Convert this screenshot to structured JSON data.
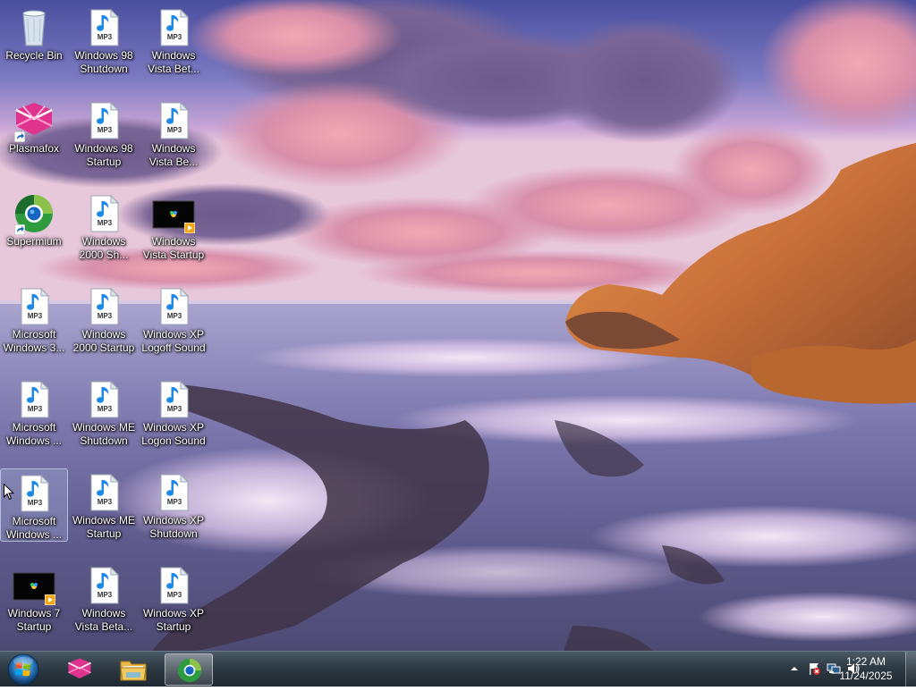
{
  "desktop": {
    "icons": [
      {
        "label": "Recycle Bin",
        "icon": "recycle-bin-icon"
      },
      {
        "label": "Plasmafox",
        "icon": "plasmafox-icon"
      },
      {
        "label": "Supermium",
        "icon": "supermium-icon"
      },
      {
        "label": "Microsoft\nWindows 3...",
        "icon": "mp3-file-icon"
      },
      {
        "label": "Microsoft\nWindows ...",
        "icon": "mp3-file-icon"
      },
      {
        "label": "Microsoft\nWindows ...",
        "icon": "mp3-file-icon"
      },
      {
        "label": "Windows 7\nStartup",
        "icon": "video-file-icon"
      },
      {
        "label": "Windows 98\nShutdown",
        "icon": "mp3-file-icon"
      },
      {
        "label": "Windows 98\nStartup",
        "icon": "mp3-file-icon"
      },
      {
        "label": "Windows\n2000 Sh...",
        "icon": "mp3-file-icon"
      },
      {
        "label": "Windows\n2000 Startup",
        "icon": "mp3-file-icon"
      },
      {
        "label": "Windows ME\nShutdown",
        "icon": "mp3-file-icon"
      },
      {
        "label": "Windows ME\nStartup",
        "icon": "mp3-file-icon"
      },
      {
        "label": "Windows\nVista Beta...",
        "icon": "mp3-file-icon"
      },
      {
        "label": "Windows\nVista Bet...",
        "icon": "mp3-file-icon"
      },
      {
        "label": "Windows\nVista Be...",
        "icon": "mp3-file-icon"
      },
      {
        "label": "Windows\nVista Startup",
        "icon": "video-file-icon"
      },
      {
        "label": "Windows XP\nLogoff Sound",
        "icon": "mp3-file-icon"
      },
      {
        "label": "Windows XP\nLogon Sound",
        "icon": "mp3-file-icon"
      },
      {
        "label": "Windows XP\nShutdown",
        "icon": "mp3-file-icon"
      },
      {
        "label": "Windows XP\nStartup",
        "icon": "mp3-file-icon"
      }
    ],
    "mp3_badge": "MP3"
  },
  "taskbar": {
    "start": "start-orb-icon",
    "pinned": [
      {
        "name": "plasmafox-icon",
        "active": false
      },
      {
        "name": "file-explorer-icon",
        "active": false
      },
      {
        "name": "supermium-icon",
        "active": true
      }
    ],
    "tray": {
      "icons": [
        "show-hidden-icons-chevron",
        "action-center-flag-icon",
        "network-icon",
        "volume-icon"
      ],
      "time": "1:22 AM",
      "date": "11/24/2025"
    }
  },
  "colors": {
    "taskbar": "#2e3a44",
    "icon_label": "#ffffff",
    "mp3_note": "#1e88e5",
    "plasmafox": "#e83e8c"
  }
}
